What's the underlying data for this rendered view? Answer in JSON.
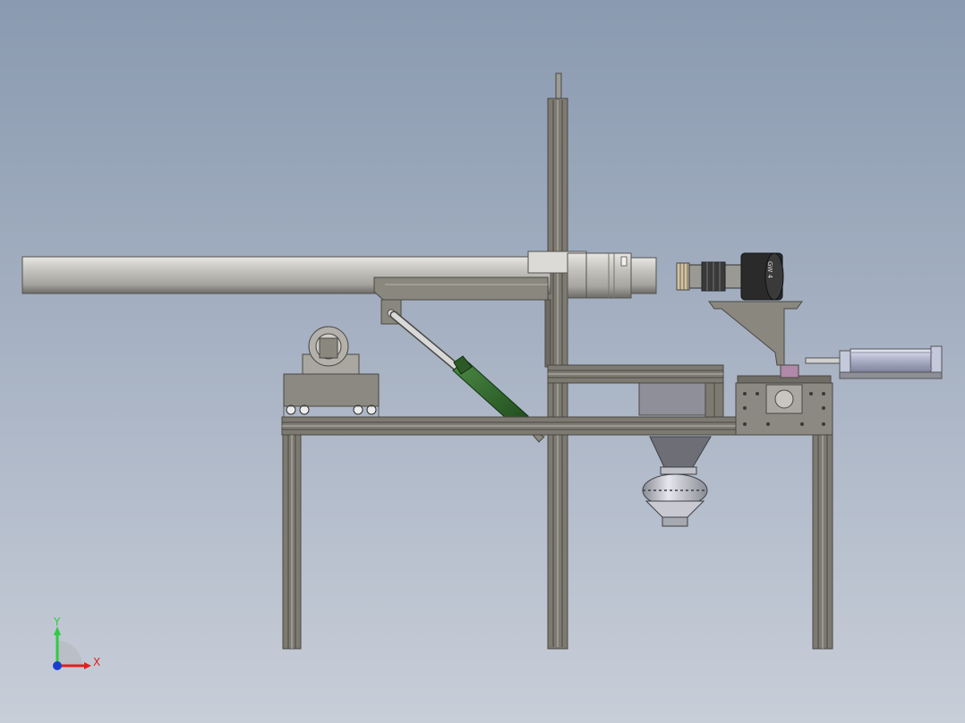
{
  "view": {
    "background_top": "#8a9ab0",
    "background_bottom": "#c8ced8"
  },
  "triad": {
    "y_label": "Y",
    "x_label": "X",
    "y_color": "#2ecc40",
    "x_color": "#e02020",
    "origin_color": "#1a3fd0"
  },
  "motor": {
    "label": "GW 4"
  },
  "colors": {
    "frame": "#7d7a72",
    "frame_dark": "#4a4843",
    "tube": "#c9c7c2",
    "hydraulic": "#2f6b2a",
    "cylinder": "#c4c9dc",
    "motor_body": "#2a2a2a"
  }
}
